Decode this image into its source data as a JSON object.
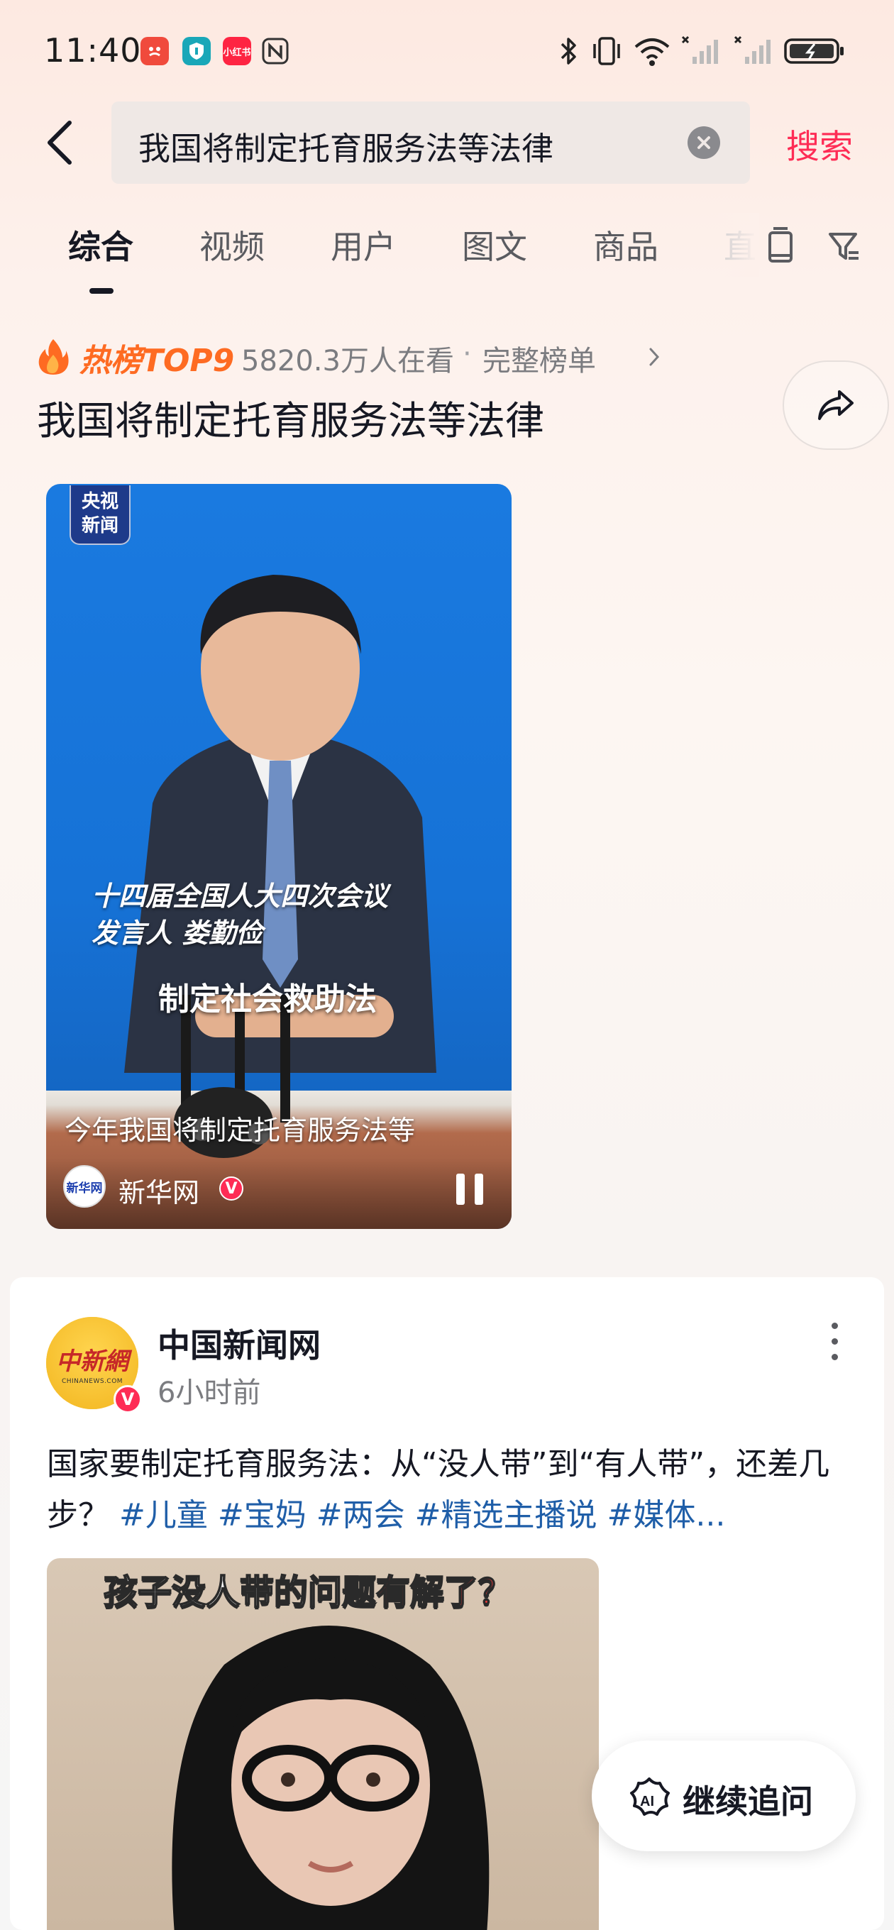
{
  "status_bar": {
    "time": "11:40",
    "app_icons": [
      "notification-icon",
      "shield-icon",
      "xiaohongshu-icon",
      "nfc-icon"
    ],
    "xiaohongshu_label": "小红书",
    "right_icons": [
      "bluetooth-icon",
      "vibrate-icon",
      "wifi-icon",
      "signal-icon",
      "signal-icon",
      "battery-icon"
    ]
  },
  "search": {
    "query": "我国将制定托育服务法等法律",
    "submit_label": "搜索"
  },
  "tabs": [
    {
      "label": "综合",
      "active": true
    },
    {
      "label": "视频"
    },
    {
      "label": "用户"
    },
    {
      "label": "图文"
    },
    {
      "label": "商品"
    },
    {
      "label": "直"
    }
  ],
  "hot": {
    "label": "热榜TOP9",
    "viewers": "5820.3万人在看",
    "separator": "·",
    "full_list": "完整榜单",
    "title": "我国将制定托育服务法等法律"
  },
  "video": {
    "badge_line1": "央视",
    "badge_line2": "新闻",
    "caption1": "十四届全国人大四次会议",
    "caption2": "发言人  娄勤俭",
    "caption3": "制定社会救助法",
    "title": "今年我国将制定托育服务法等",
    "source_name": "新华网",
    "source_avatar_text": "新华网",
    "verified": "V"
  },
  "post": {
    "author": "中国新闻网",
    "avatar_logo": "中新網",
    "avatar_sub": "CHINANEWS.COM",
    "verified": "V",
    "time": "6小时前",
    "text": "国家要制定托育服务法：从“没人带”到“有人带”，还差几步？",
    "tags": [
      "#儿童",
      "#宝妈",
      "#两会",
      "#精选主播说",
      "#媒体..."
    ],
    "image_caption_normal": "孩子没人带的问题",
    "image_caption_highlight": "有解了？"
  },
  "float_button": {
    "label": "继续追问",
    "icon_text": "AI"
  },
  "colors": {
    "accent": "#fe2c55",
    "hot_orange": "#fe6b22",
    "hashtag": "#1f5ea8"
  }
}
